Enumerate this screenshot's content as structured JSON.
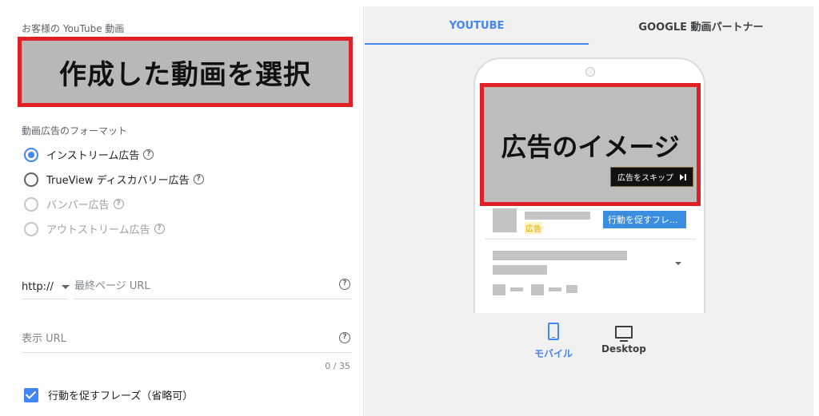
{
  "left": {
    "video_section_label": "お客様の YouTube 動画",
    "video_selector_text": "作成した動画を選択",
    "format_section_label": "動画広告のフォーマット",
    "formats": [
      {
        "label": "インストリーム広告",
        "selected": true,
        "disabled": false
      },
      {
        "label": "TrueView ディスカバリー広告",
        "selected": false,
        "disabled": false
      },
      {
        "label": "バンパー広告",
        "selected": false,
        "disabled": true
      },
      {
        "label": "アウトストリーム広告",
        "selected": false,
        "disabled": true
      }
    ],
    "protocol_select": "http://",
    "final_url_placeholder": "最終ページ URL",
    "display_url_placeholder": "表示 URL",
    "display_url_counter": "0 / 35",
    "cta_checkbox_label": "行動を促すフレーズ（省略可）",
    "cta_checked": true,
    "help_glyph": "?"
  },
  "right": {
    "tabs": [
      {
        "label": "YOUTUBE",
        "active": true
      },
      {
        "label": "GOOGLE 動画パートナー",
        "active": false
      }
    ],
    "preview": {
      "ad_image_text": "広告のイメージ",
      "skip_button": "広告をスキップ",
      "ad_tag": "広告",
      "cta_button": "行動を促すフレ..."
    },
    "devices": [
      {
        "label": "モバイル",
        "icon": "mobile-icon",
        "active": true
      },
      {
        "label": "Desktop",
        "icon": "desktop-icon",
        "active": false
      }
    ]
  },
  "colors": {
    "accent": "#4285f4",
    "highlight_border": "#e02027",
    "cta_blue": "#3b8de0"
  }
}
